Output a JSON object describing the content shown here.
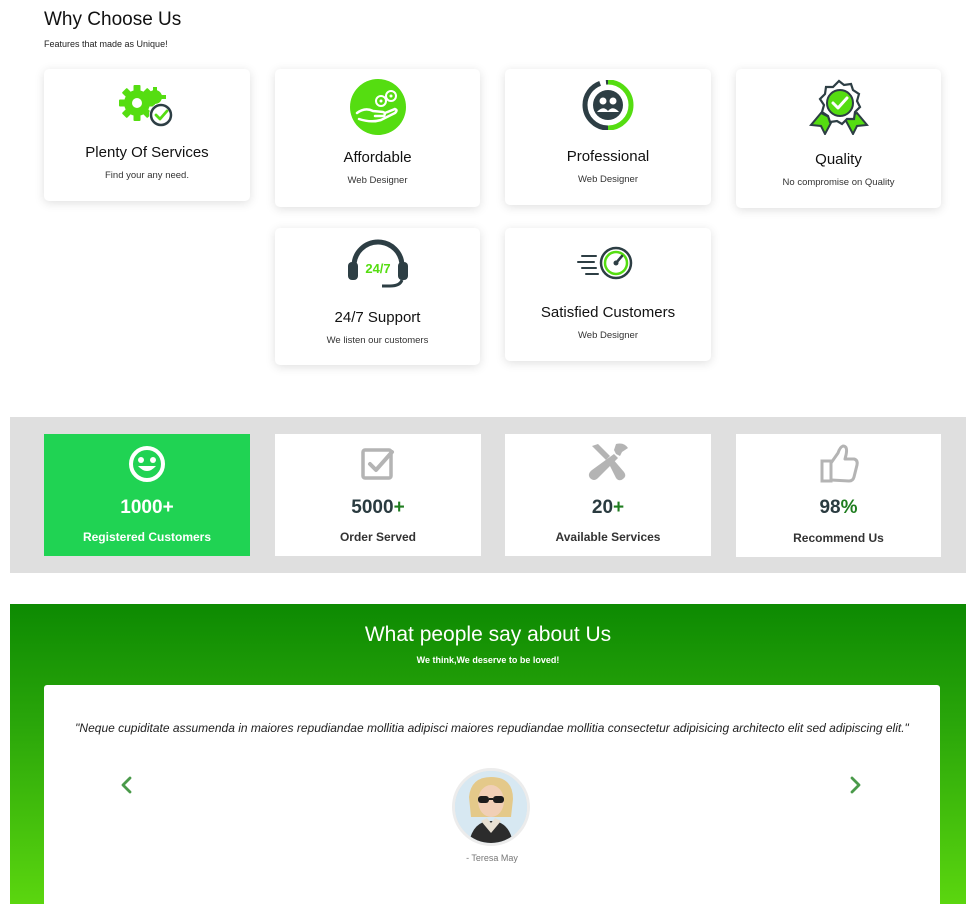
{
  "why": {
    "title": "Why Choose Us",
    "subtitle": "Features that made as Unique!"
  },
  "features": [
    {
      "title": "Plenty Of Services",
      "subtitle": "Find your any need.",
      "icon": "gears-check-icon"
    },
    {
      "title": "Affordable",
      "subtitle": "Web Designer",
      "icon": "money-hand-icon"
    },
    {
      "title": "Professional",
      "subtitle": "Web Designer",
      "icon": "team-circle-icon"
    },
    {
      "title": "Quality",
      "subtitle": "No compromise on Quality",
      "icon": "quality-badge-icon"
    },
    {
      "title": "24/7 Support",
      "subtitle": "We listen our customers",
      "icon": "headset-247-icon"
    },
    {
      "title": "Satisfied Customers",
      "subtitle": "Web Designer",
      "icon": "speedometer-icon"
    }
  ],
  "stats": [
    {
      "number": "1000",
      "suffix": "+",
      "label": "Registered Customers",
      "icon": "smiley-icon",
      "active": true
    },
    {
      "number": "5000",
      "suffix": "+",
      "label": "Order Served",
      "icon": "checkbox-icon",
      "active": false
    },
    {
      "number": "20",
      "suffix": "+",
      "label": "Available Services",
      "icon": "tools-icon",
      "active": false
    },
    {
      "number": "98",
      "suffix": "%",
      "label": "Recommend Us",
      "icon": "thumbs-up-icon",
      "active": false
    }
  ],
  "testimonials": {
    "title": "What people say about Us",
    "subtitle": "We think,We deserve to be loved!",
    "quote": "\"Neque cupiditate assumenda in maiores repudiandae mollitia adipisci maiores repudiandae mollitia consectetur adipisicing architecto elit sed adipiscing elit.\"",
    "author": "- Teresa May",
    "prev_icon": "chevron-left-icon",
    "next_icon": "chevron-right-icon"
  },
  "colors": {
    "accent_green": "#20d353",
    "icon_green": "#55dd11",
    "dark_icon": "#2d3e44",
    "plus_green": "#1f7d1f",
    "gradient_top": "#0d8a02",
    "gradient_bottom": "#5bd60f"
  }
}
